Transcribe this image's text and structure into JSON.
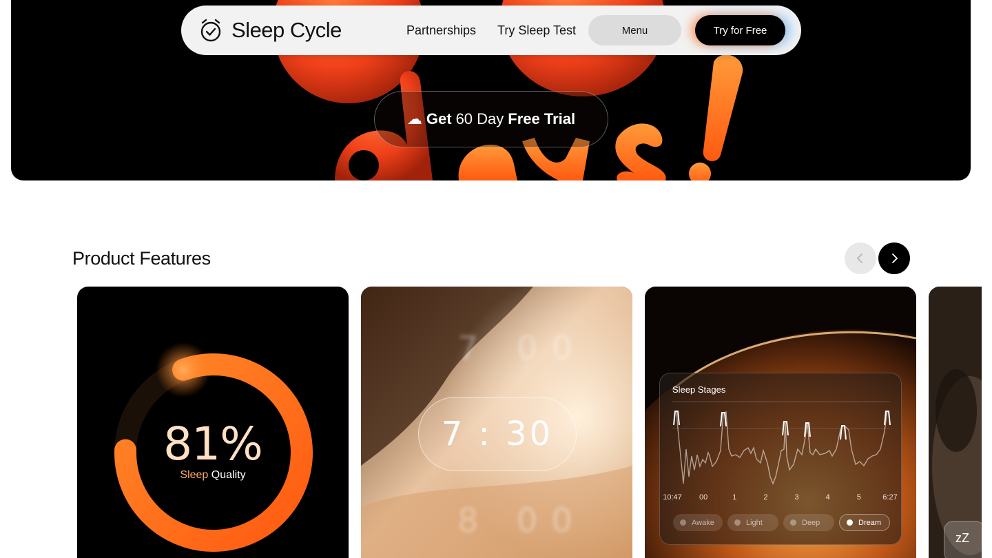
{
  "nav": {
    "logo_text": "Sleep Cycle",
    "links": [
      "Partnerships",
      "Try Sleep Test"
    ],
    "menu_label": "Menu",
    "cta_label": "Try for Free"
  },
  "hero": {
    "trial_get": "Get",
    "trial_mid": "60 Day",
    "trial_end": "Free Trial"
  },
  "features": {
    "title": "Product Features",
    "cards": [
      {
        "value": "81%",
        "label_accent": "Sleep",
        "label_rest": "Quality",
        "progress_fraction": 0.81
      },
      {
        "time_main": "7 : 30",
        "time_above": "7 00",
        "time_below": "8 00"
      },
      {
        "title": "Sleep Stages",
        "x_ticks": [
          "10:47",
          "00",
          "1",
          "2",
          "3",
          "4",
          "5",
          "6:27"
        ],
        "legend": [
          "Awake",
          "Light",
          "Deep",
          "Dream"
        ],
        "active_legend": "Dream"
      },
      {
        "badge": "zZ"
      }
    ]
  },
  "colors": {
    "accent_orange": "#ff7a1a",
    "cta_bg": "#000000",
    "menu_bg": "#dcdcdc",
    "nav_bg": "#f2f2f2"
  }
}
